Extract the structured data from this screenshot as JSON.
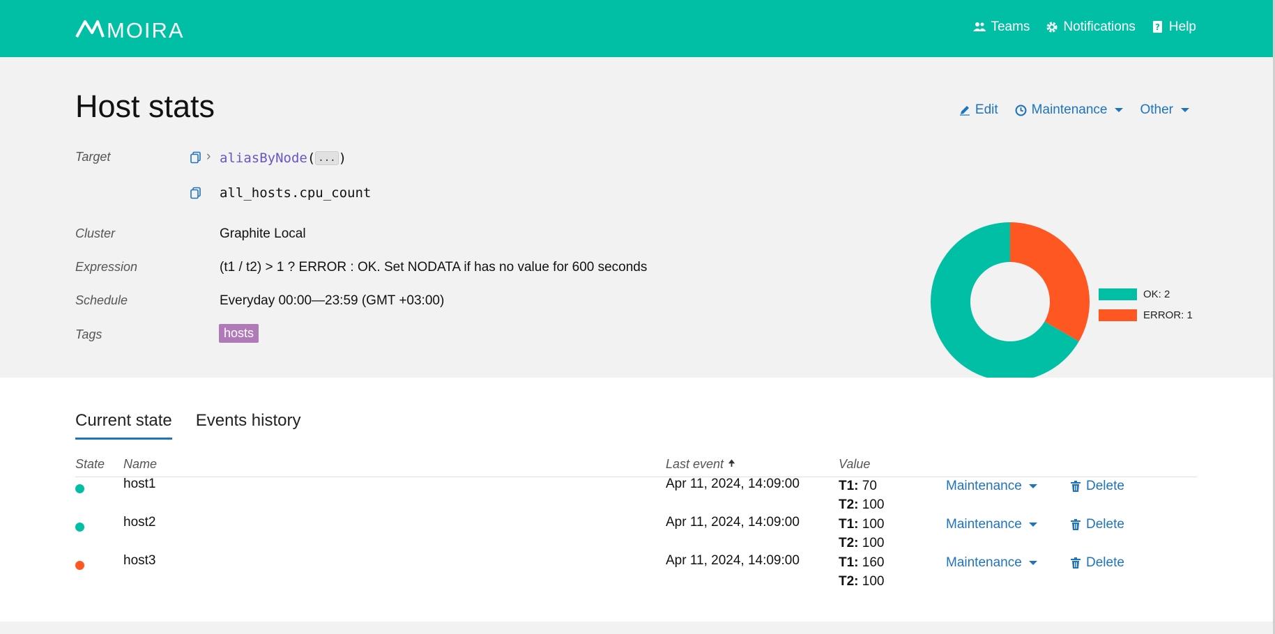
{
  "header": {
    "logo_text": "MOIRA",
    "nav": [
      {
        "label": "Teams",
        "icon": "team-icon"
      },
      {
        "label": "Notifications",
        "icon": "gear-icon"
      },
      {
        "label": "Help",
        "icon": "help-icon"
      }
    ]
  },
  "trigger": {
    "title": "Host stats",
    "actions": {
      "edit": "Edit",
      "maintenance": "Maintenance",
      "other": "Other"
    },
    "target_label": "Target",
    "target_fn": "aliasByNode",
    "target_paren_open": "(",
    "target_paren_close": ")",
    "target_ellipsis": "...",
    "target_chevron": "›",
    "target_metric": "all_hosts.cpu_count",
    "cluster_label": "Cluster",
    "cluster_value": "Graphite Local",
    "expression_label": "Expression",
    "expression_value": "(t1 / t2) > 1 ? ERROR : OK. Set NODATA if has no value for 600 seconds",
    "schedule_label": "Schedule",
    "schedule_value": "Everyday 00:00—23:59 (GMT +03:00)",
    "tags_label": "Tags",
    "tag": "hosts"
  },
  "chart_data": {
    "type": "pie",
    "donut": true,
    "series": [
      {
        "name": "OK",
        "value": 2,
        "color": "#00bfa5",
        "label": "OK: 2"
      },
      {
        "name": "ERROR",
        "value": 1,
        "color": "#ff5722",
        "label": "ERROR: 1"
      }
    ],
    "legend": "right"
  },
  "tabs": [
    "Current state",
    "Events history"
  ],
  "table": {
    "headers": {
      "state": "State",
      "name": "Name",
      "last_event": "Last event",
      "value": "Value"
    },
    "rows": [
      {
        "state": "OK",
        "color": "#00bfa5",
        "name": "host1",
        "last_event": "Apr 11, 2024, 14:09:00",
        "t1_label": "T1:",
        "t1": "70",
        "t2_label": "T2:",
        "t2": "100",
        "maintenance": "Maintenance",
        "delete": "Delete"
      },
      {
        "state": "OK",
        "color": "#00bfa5",
        "name": "host2",
        "last_event": "Apr 11, 2024, 14:09:00",
        "t1_label": "T1:",
        "t1": "100",
        "t2_label": "T2:",
        "t2": "100",
        "maintenance": "Maintenance",
        "delete": "Delete"
      },
      {
        "state": "ERROR",
        "color": "#ff5722",
        "name": "host3",
        "last_event": "Apr 11, 2024, 14:09:00",
        "t1_label": "T1:",
        "t1": "160",
        "t2_label": "T2:",
        "t2": "100",
        "maintenance": "Maintenance",
        "delete": "Delete"
      }
    ]
  }
}
